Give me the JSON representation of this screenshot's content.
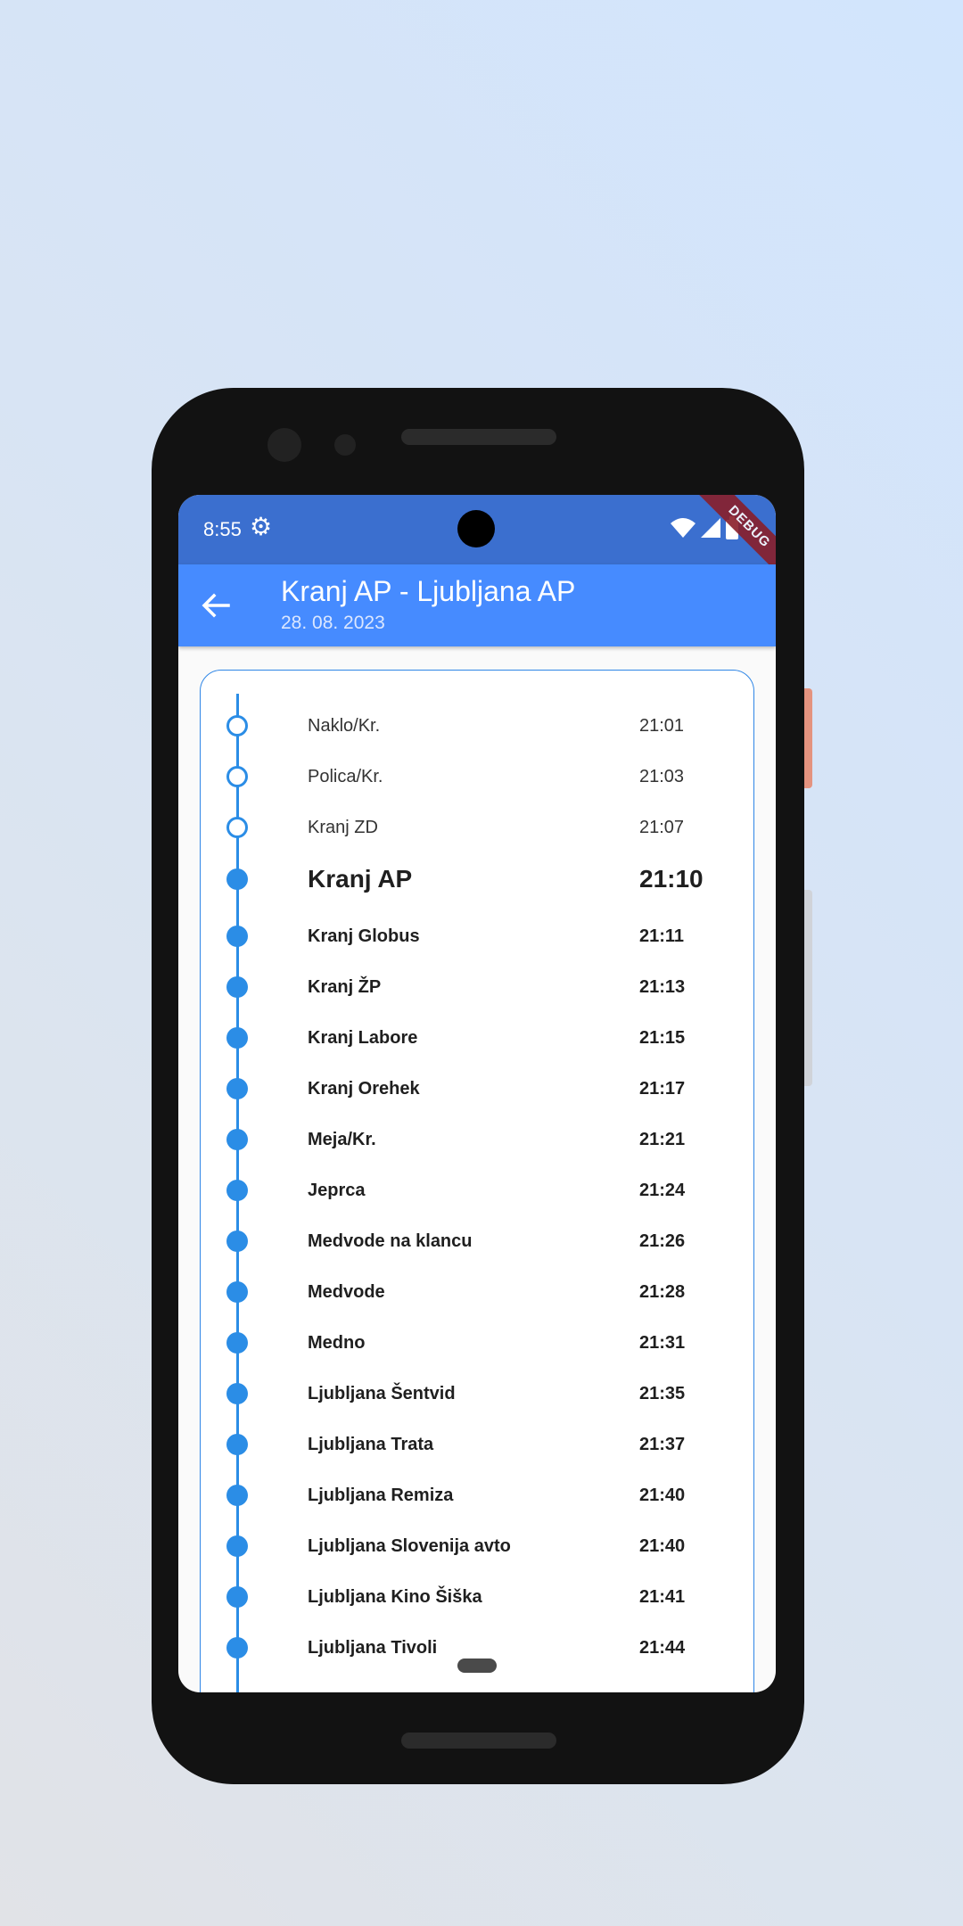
{
  "status": {
    "time": "8:55"
  },
  "debug_label": "DEBUG",
  "appbar": {
    "title": "Kranj AP - Ljubljana AP",
    "date": "28. 08. 2023"
  },
  "colors": {
    "appbar": "#468bff",
    "statusbar": "#3b6fcf",
    "timeline": "#2b8de6"
  },
  "stops": [
    {
      "name": "Naklo/Kr.",
      "time": "21:01",
      "state": "past"
    },
    {
      "name": "Polica/Kr.",
      "time": "21:03",
      "state": "past"
    },
    {
      "name": "Kranj ZD",
      "time": "21:07",
      "state": "past"
    },
    {
      "name": "Kranj AP",
      "time": "21:10",
      "state": "current"
    },
    {
      "name": "Kranj Globus",
      "time": "21:11",
      "state": "next"
    },
    {
      "name": "Kranj ŽP",
      "time": "21:13",
      "state": "next"
    },
    {
      "name": "Kranj Labore",
      "time": "21:15",
      "state": "next"
    },
    {
      "name": "Kranj Orehek",
      "time": "21:17",
      "state": "next"
    },
    {
      "name": "Meja/Kr.",
      "time": "21:21",
      "state": "next"
    },
    {
      "name": "Jeprca",
      "time": "21:24",
      "state": "next"
    },
    {
      "name": "Medvode na klancu",
      "time": "21:26",
      "state": "next"
    },
    {
      "name": "Medvode",
      "time": "21:28",
      "state": "next"
    },
    {
      "name": "Medno",
      "time": "21:31",
      "state": "next"
    },
    {
      "name": "Ljubljana Šentvid",
      "time": "21:35",
      "state": "next"
    },
    {
      "name": "Ljubljana Trata",
      "time": "21:37",
      "state": "next"
    },
    {
      "name": "Ljubljana Remiza",
      "time": "21:40",
      "state": "next"
    },
    {
      "name": "Ljubljana Slovenija avto",
      "time": "21:40",
      "state": "next"
    },
    {
      "name": "Ljubljana Kino Šiška",
      "time": "21:41",
      "state": "next"
    },
    {
      "name": "Ljubljana Tivoli",
      "time": "21:44",
      "state": "next"
    }
  ]
}
